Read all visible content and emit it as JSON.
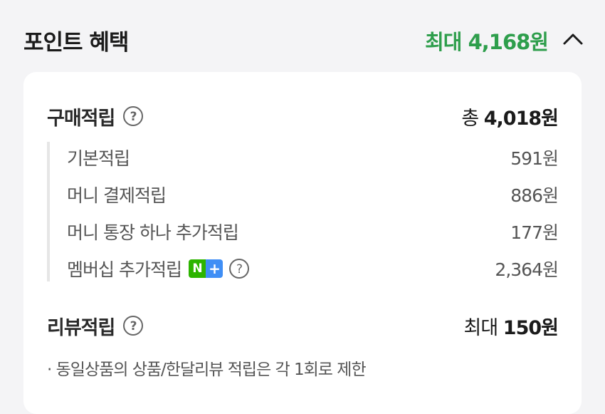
{
  "header": {
    "title": "포인트 혜택",
    "max_prefix": "최대",
    "max_amount": "4,168원"
  },
  "purchase": {
    "label": "구매적립",
    "total_prefix": "총",
    "total_amount": "4,018원",
    "items": [
      {
        "label": "기본적립",
        "value": "591원"
      },
      {
        "label": "머니 결제적립",
        "value": "886원"
      },
      {
        "label": "머니 통장 하나 추가적립",
        "value": "177원"
      },
      {
        "label": "멤버십 추가적립",
        "value": "2,364원"
      }
    ],
    "membership_badge": {
      "n": "N",
      "plus": "+"
    }
  },
  "review": {
    "label": "리뷰적립",
    "max_prefix": "최대",
    "max_amount": "150원",
    "note": "· 동일상품의 상품/한달리뷰 적립은 각 1회로 제한"
  },
  "colors": {
    "accent_green": "#2e9e4c",
    "badge_green": "#2db400",
    "badge_blue": "#3f8ef5"
  },
  "icons": {
    "collapse": "chevron-up-icon",
    "help": "question-circle-icon"
  }
}
